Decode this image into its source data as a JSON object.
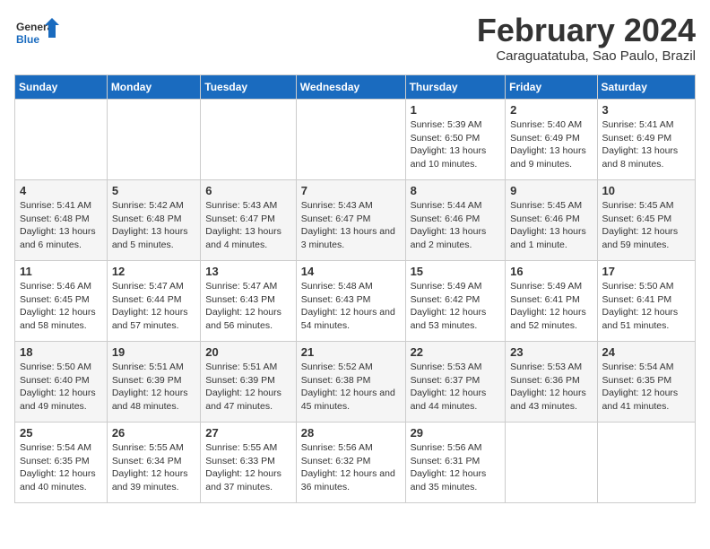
{
  "logo": {
    "line1": "General",
    "line2": "Blue"
  },
  "header": {
    "month_year": "February 2024",
    "location": "Caraguatatuba, Sao Paulo, Brazil"
  },
  "weekdays": [
    "Sunday",
    "Monday",
    "Tuesday",
    "Wednesday",
    "Thursday",
    "Friday",
    "Saturday"
  ],
  "weeks": [
    [
      {
        "day": "",
        "info": ""
      },
      {
        "day": "",
        "info": ""
      },
      {
        "day": "",
        "info": ""
      },
      {
        "day": "",
        "info": ""
      },
      {
        "day": "1",
        "info": "Sunrise: 5:39 AM\nSunset: 6:50 PM\nDaylight: 13 hours\nand 10 minutes."
      },
      {
        "day": "2",
        "info": "Sunrise: 5:40 AM\nSunset: 6:49 PM\nDaylight: 13 hours\nand 9 minutes."
      },
      {
        "day": "3",
        "info": "Sunrise: 5:41 AM\nSunset: 6:49 PM\nDaylight: 13 hours\nand 8 minutes."
      }
    ],
    [
      {
        "day": "4",
        "info": "Sunrise: 5:41 AM\nSunset: 6:48 PM\nDaylight: 13 hours\nand 6 minutes."
      },
      {
        "day": "5",
        "info": "Sunrise: 5:42 AM\nSunset: 6:48 PM\nDaylight: 13 hours\nand 5 minutes."
      },
      {
        "day": "6",
        "info": "Sunrise: 5:43 AM\nSunset: 6:47 PM\nDaylight: 13 hours\nand 4 minutes."
      },
      {
        "day": "7",
        "info": "Sunrise: 5:43 AM\nSunset: 6:47 PM\nDaylight: 13 hours\nand 3 minutes."
      },
      {
        "day": "8",
        "info": "Sunrise: 5:44 AM\nSunset: 6:46 PM\nDaylight: 13 hours\nand 2 minutes."
      },
      {
        "day": "9",
        "info": "Sunrise: 5:45 AM\nSunset: 6:46 PM\nDaylight: 13 hours\nand 1 minute."
      },
      {
        "day": "10",
        "info": "Sunrise: 5:45 AM\nSunset: 6:45 PM\nDaylight: 12 hours\nand 59 minutes."
      }
    ],
    [
      {
        "day": "11",
        "info": "Sunrise: 5:46 AM\nSunset: 6:45 PM\nDaylight: 12 hours\nand 58 minutes."
      },
      {
        "day": "12",
        "info": "Sunrise: 5:47 AM\nSunset: 6:44 PM\nDaylight: 12 hours\nand 57 minutes."
      },
      {
        "day": "13",
        "info": "Sunrise: 5:47 AM\nSunset: 6:43 PM\nDaylight: 12 hours\nand 56 minutes."
      },
      {
        "day": "14",
        "info": "Sunrise: 5:48 AM\nSunset: 6:43 PM\nDaylight: 12 hours\nand 54 minutes."
      },
      {
        "day": "15",
        "info": "Sunrise: 5:49 AM\nSunset: 6:42 PM\nDaylight: 12 hours\nand 53 minutes."
      },
      {
        "day": "16",
        "info": "Sunrise: 5:49 AM\nSunset: 6:41 PM\nDaylight: 12 hours\nand 52 minutes."
      },
      {
        "day": "17",
        "info": "Sunrise: 5:50 AM\nSunset: 6:41 PM\nDaylight: 12 hours\nand 51 minutes."
      }
    ],
    [
      {
        "day": "18",
        "info": "Sunrise: 5:50 AM\nSunset: 6:40 PM\nDaylight: 12 hours\nand 49 minutes."
      },
      {
        "day": "19",
        "info": "Sunrise: 5:51 AM\nSunset: 6:39 PM\nDaylight: 12 hours\nand 48 minutes."
      },
      {
        "day": "20",
        "info": "Sunrise: 5:51 AM\nSunset: 6:39 PM\nDaylight: 12 hours\nand 47 minutes."
      },
      {
        "day": "21",
        "info": "Sunrise: 5:52 AM\nSunset: 6:38 PM\nDaylight: 12 hours\nand 45 minutes."
      },
      {
        "day": "22",
        "info": "Sunrise: 5:53 AM\nSunset: 6:37 PM\nDaylight: 12 hours\nand 44 minutes."
      },
      {
        "day": "23",
        "info": "Sunrise: 5:53 AM\nSunset: 6:36 PM\nDaylight: 12 hours\nand 43 minutes."
      },
      {
        "day": "24",
        "info": "Sunrise: 5:54 AM\nSunset: 6:35 PM\nDaylight: 12 hours\nand 41 minutes."
      }
    ],
    [
      {
        "day": "25",
        "info": "Sunrise: 5:54 AM\nSunset: 6:35 PM\nDaylight: 12 hours\nand 40 minutes."
      },
      {
        "day": "26",
        "info": "Sunrise: 5:55 AM\nSunset: 6:34 PM\nDaylight: 12 hours\nand 39 minutes."
      },
      {
        "day": "27",
        "info": "Sunrise: 5:55 AM\nSunset: 6:33 PM\nDaylight: 12 hours\nand 37 minutes."
      },
      {
        "day": "28",
        "info": "Sunrise: 5:56 AM\nSunset: 6:32 PM\nDaylight: 12 hours\nand 36 minutes."
      },
      {
        "day": "29",
        "info": "Sunrise: 5:56 AM\nSunset: 6:31 PM\nDaylight: 12 hours\nand 35 minutes."
      },
      {
        "day": "",
        "info": ""
      },
      {
        "day": "",
        "info": ""
      }
    ]
  ]
}
